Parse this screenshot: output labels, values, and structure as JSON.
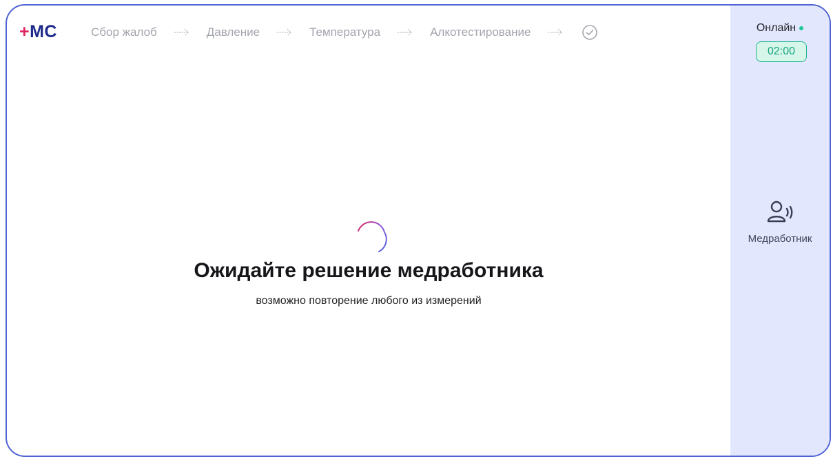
{
  "logo": {
    "plus": "+",
    "text": "MC"
  },
  "steps": [
    {
      "label": "Сбор жалоб"
    },
    {
      "label": "Давление"
    },
    {
      "label": "Температура"
    },
    {
      "label": "Алкотестирование"
    }
  ],
  "main": {
    "title": "Ожидайте решение медработника",
    "subtitle": "возможно повторение любого из измерений"
  },
  "sidebar": {
    "status": "Онлайн",
    "timer": "02:00",
    "medic_label": "Медработник"
  },
  "colors": {
    "accent": "#4f63d4",
    "logo_plus": "#e0245e",
    "logo_text": "#1e2b8c",
    "online": "#1dc79b",
    "sidebar_bg": "#e3e7fd",
    "step_inactive": "#a3a5ad"
  },
  "icons": {
    "step_arrow": "arrow-right-icon",
    "final_step": "check-circle-icon",
    "loading": "spinner-icon",
    "medic": "user-voice-icon"
  }
}
